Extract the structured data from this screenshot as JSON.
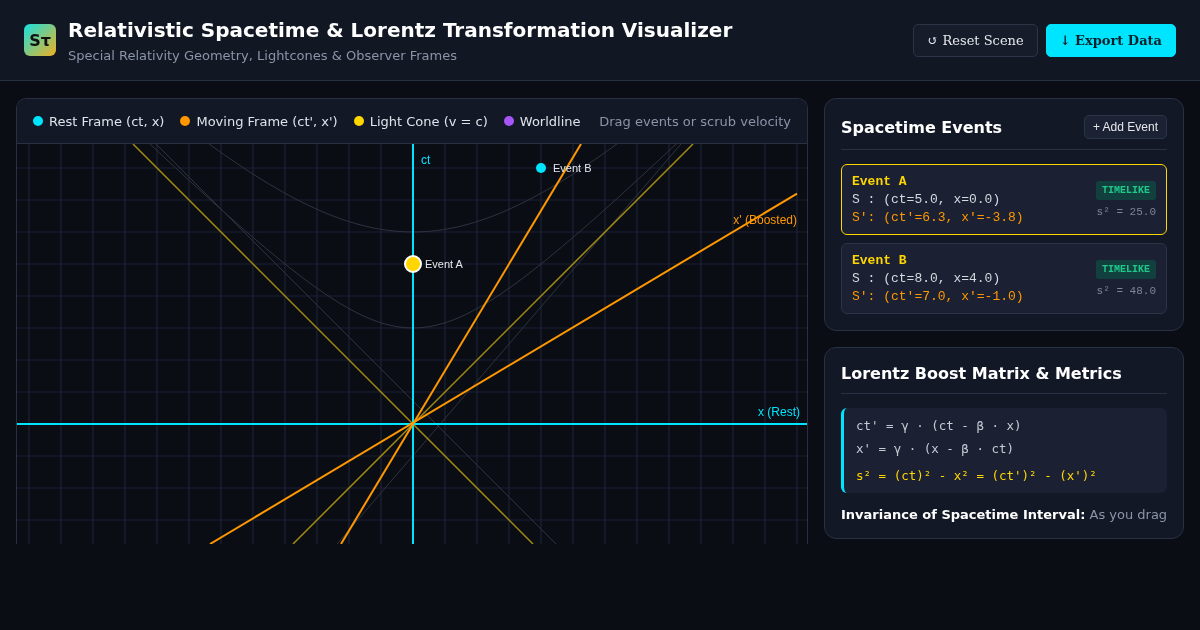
{
  "header": {
    "logo": "Sτ",
    "title": "Relativistic Spacetime & Lorentz Transformation Visualizer",
    "subtitle": "Special Relativity Geometry, Lightcones & Observer Frames",
    "buttons": [
      {
        "label": "↺ Reset Scene",
        "kind": "secondary"
      },
      {
        "label": "↓ Export Data",
        "kind": "primary"
      }
    ]
  },
  "diagram": {
    "legend": [
      {
        "label": "Rest Frame (ct, x)",
        "color": "#00e5ff"
      },
      {
        "label": "Moving Frame (ct', x')",
        "color": "#ff9800"
      },
      {
        "label": "Light Cone (v = c)",
        "color": "#ffd600"
      },
      {
        "label": "Worldline",
        "color": "#a855f7"
      }
    ],
    "hint": "Drag events or scrub velocity",
    "axis_labels": {
      "ct": "ct",
      "x": "x (Rest)",
      "x_boosted": "x' (Boosted)"
    },
    "events": [
      {
        "label": "Event A",
        "selected": true
      },
      {
        "label": "Event B",
        "selected": false
      }
    ]
  },
  "events_panel": {
    "title": "Spacetime Events",
    "add_button": "+ Add Event",
    "events": [
      {
        "name": "Event A",
        "rest": "S : (ct=5.0, x=0.0)",
        "moving": "S': (ct'=6.3, x'=-3.8)",
        "badge": "TIMELIKE",
        "interval": "s² = 25.0",
        "selected": true
      },
      {
        "name": "Event B",
        "rest": "S : (ct=8.0, x=4.0)",
        "moving": "S': (ct'=7.0, x'=-1.0)",
        "badge": "TIMELIKE",
        "interval": "s² = 48.0",
        "selected": false
      }
    ]
  },
  "metrics_panel": {
    "title": "Lorentz Boost Matrix & Metrics",
    "equations": [
      {
        "text": "ct' = γ · (ct - β · x)",
        "kind": "transform"
      },
      {
        "text": "x' = γ · (x - β · ct)",
        "kind": "transform"
      },
      {
        "text": "s² = (ct)² - x² = (ct')² - (x')²",
        "kind": "invariant"
      }
    ],
    "note": "**Invariance of Spacetime Interval:** As you drag"
  }
}
